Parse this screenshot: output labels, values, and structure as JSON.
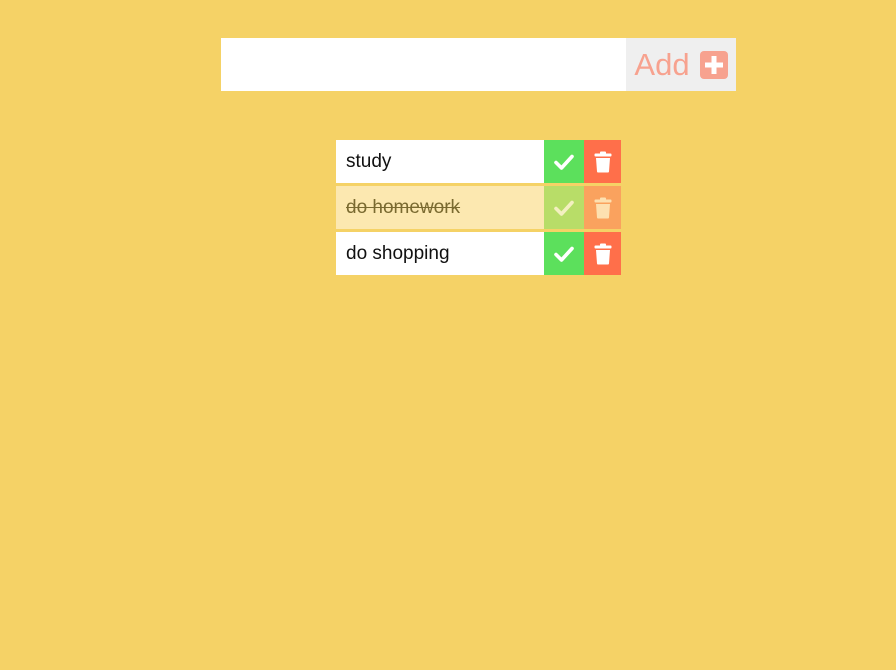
{
  "add_form": {
    "input_value": "",
    "input_placeholder": "",
    "add_label": "Add",
    "add_icon": "plus-square-icon"
  },
  "todos": [
    {
      "text": "study",
      "completed": false
    },
    {
      "text": "do homework",
      "completed": true
    },
    {
      "text": "do shopping",
      "completed": false
    }
  ],
  "colors": {
    "background": "#f5d266",
    "complete": "#5ce05c",
    "delete": "#ff6f4a",
    "add_accent": "#f7a28f",
    "completed_row": "#fce8b0"
  }
}
